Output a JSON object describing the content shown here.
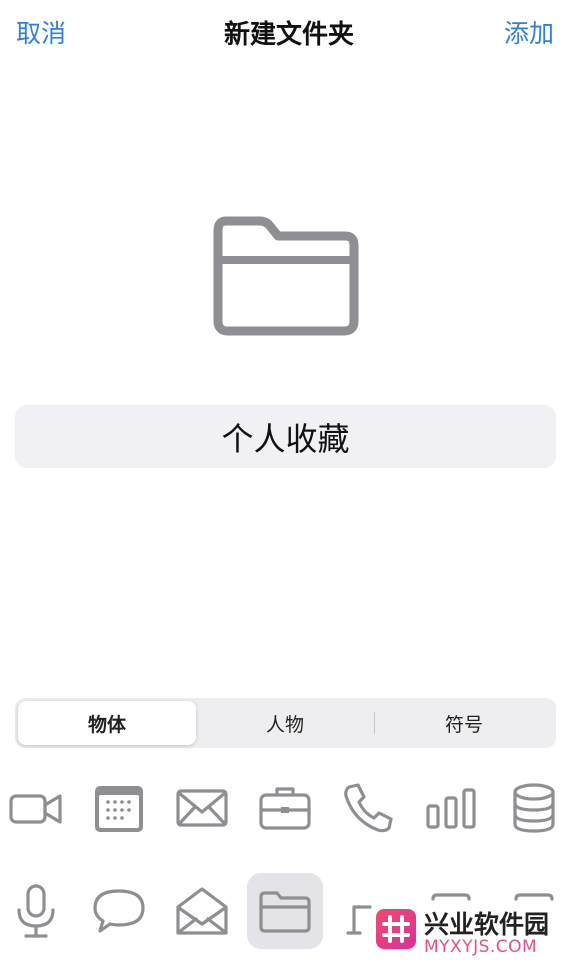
{
  "nav": {
    "cancel_label": "取消",
    "title": "新建文件夹",
    "add_label": "添加"
  },
  "preview": {
    "icon": "folder-icon"
  },
  "name_field": {
    "value": "个人收藏"
  },
  "segments": [
    {
      "label": "物体",
      "selected": true
    },
    {
      "label": "人物",
      "selected": false
    },
    {
      "label": "符号",
      "selected": false
    }
  ],
  "icon_grid": {
    "row1": [
      "video-camera-icon",
      "calendar-icon",
      "envelope-icon",
      "briefcase-icon",
      "phone-icon",
      "bar-chart-icon",
      "database-icon"
    ],
    "row2": [
      "microphone-icon",
      "speech-bubble-icon",
      "open-envelope-icon",
      "folder-icon",
      "desk-icon",
      "tray-icon",
      "tray-icon"
    ],
    "selected": "folder-icon"
  },
  "watermark": {
    "title": "兴业软件园",
    "url": "MYXYJS.COM",
    "accent": "#e8508a"
  },
  "colors": {
    "accent": "#2f7fe0",
    "icon": "#8e8e93"
  }
}
